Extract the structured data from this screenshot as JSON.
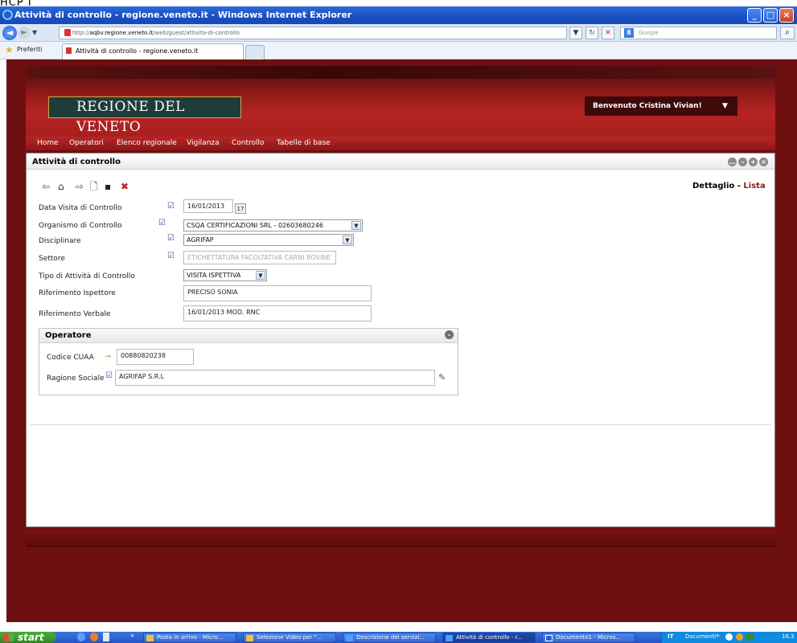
{
  "window": {
    "top_fragment": "HCP I",
    "title": "Attività di controllo - regione.veneto.it - Windows Internet Explorer",
    "url_prefix": "http://",
    "url_domain": "aqbv.regione.veneto.it",
    "url_path": "/web/guest/attivita-di-controllo",
    "search_placeholder": "Google",
    "favorites_label": "Preferiti",
    "tab_label": "Attività di controllo - regione.veneto.it"
  },
  "site": {
    "logo_text": "REGIONE DEL VENETO",
    "welcome": "Benvenuto Cristina Vivian!",
    "nav": [
      "Home",
      "Operatori",
      "Elenco regionale",
      "Vigilanza",
      "Controllo",
      "Tabelle di base"
    ]
  },
  "panel": {
    "title": "Attività di controllo",
    "detail_label": "Dettaglio",
    "separator": "-",
    "list_label": "Lista"
  },
  "form": {
    "data_visita_label": "Data Visita di Controllo",
    "data_visita_value": "16/01/2013",
    "organismo_label": "Organismo di Controllo",
    "organismo_value": "CSQA CERTIFICAZIONI SRL - 02603680246",
    "disciplinare_label": "Disciplinare",
    "disciplinare_value": "AGRIFAP",
    "settore_label": "Settore",
    "settore_value": "ETICHETTATURA FACOLTATIVA CARNI BOVINE",
    "tipo_label": "Tipo di Attività di Controllo",
    "tipo_value": "VISITA ISPETTIVA",
    "ispettore_label": "Riferimento Ispettore",
    "ispettore_value": "PRECISO SONIA",
    "verbale_label": "Riferimento Verbale",
    "verbale_value": "16/01/2013 MOD. RNC"
  },
  "operatore": {
    "title": "Operatore",
    "cuaa_label": "Codice CUAA",
    "cuaa_value": "00880820238",
    "ragione_label": "Ragione Sociale",
    "ragione_value": "AGRIFAP S.R.L"
  },
  "taskbar": {
    "start": "start",
    "items": [
      "Posta in arrivo - Micro...",
      "Selezione Video per \"...",
      "Descrizione dei servizi...",
      "Attività di controllo - r...",
      "Documento1 - Micros..."
    ],
    "lang": "IT",
    "tray_label": "Documenti",
    "clock": "16.3"
  }
}
